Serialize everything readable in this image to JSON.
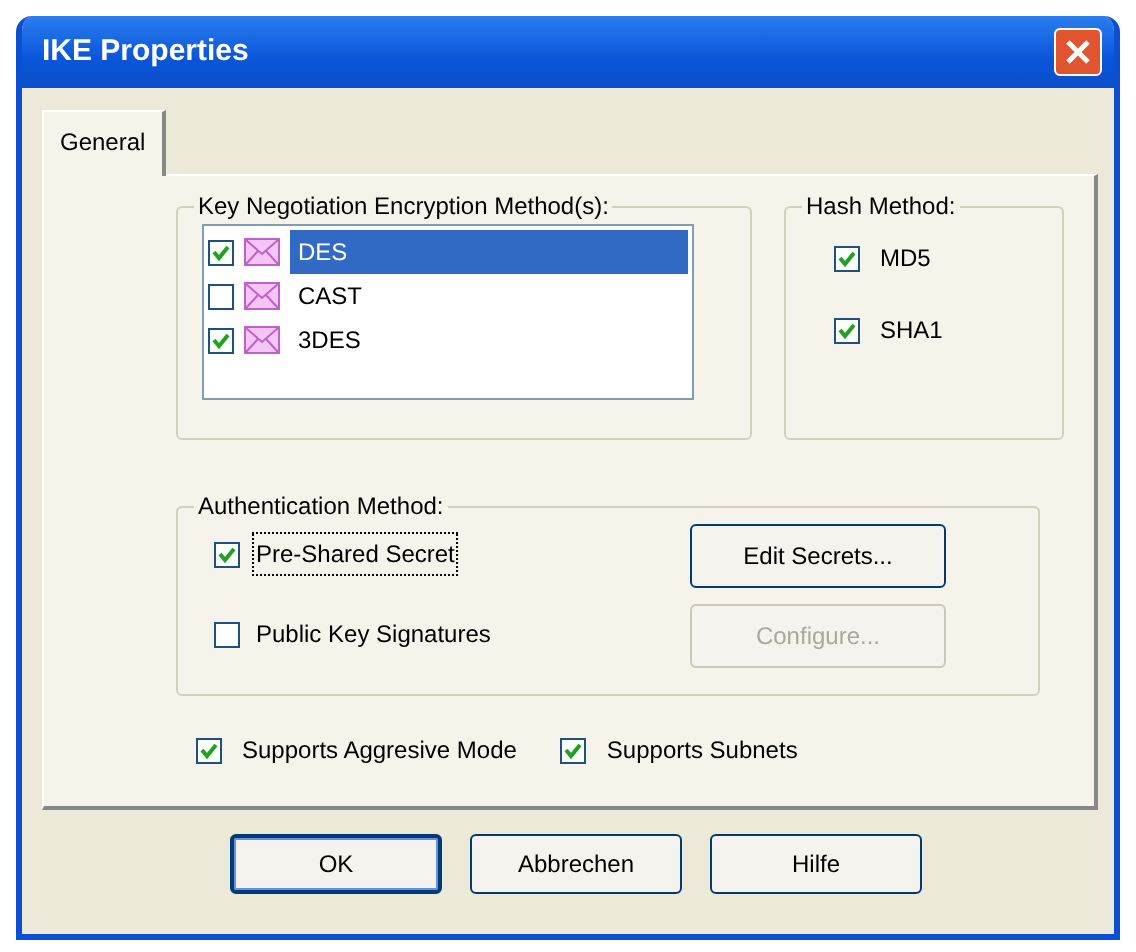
{
  "window": {
    "title": "IKE Properties"
  },
  "tabs": [
    {
      "label": "General",
      "selected": true
    }
  ],
  "encryption_group": {
    "label": "Key Negotiation Encryption Method(s):",
    "items": [
      {
        "label": "DES",
        "checked": true,
        "selected": true
      },
      {
        "label": "CAST",
        "checked": false,
        "selected": false
      },
      {
        "label": "3DES",
        "checked": true,
        "selected": false
      }
    ]
  },
  "hash_group": {
    "label": "Hash Method:",
    "items": [
      {
        "label": "MD5",
        "checked": true
      },
      {
        "label": "SHA1",
        "checked": true
      }
    ]
  },
  "auth_group": {
    "label": "Authentication Method:",
    "options": [
      {
        "label": "Pre-Shared Secret",
        "checked": true,
        "focused": true
      },
      {
        "label": "Public Key Signatures",
        "checked": false,
        "focused": false
      }
    ],
    "buttons": [
      {
        "label": "Edit Secrets...",
        "disabled": false
      },
      {
        "label": "Configure...",
        "disabled": true
      }
    ]
  },
  "options": [
    {
      "label": "Supports Aggresive Mode",
      "checked": true
    },
    {
      "label": "Supports Subnets",
      "checked": true
    }
  ],
  "buttons": [
    {
      "label": "OK",
      "default": true
    },
    {
      "label": "Abbrechen",
      "default": false
    },
    {
      "label": "Hilfe",
      "default": false
    }
  ]
}
